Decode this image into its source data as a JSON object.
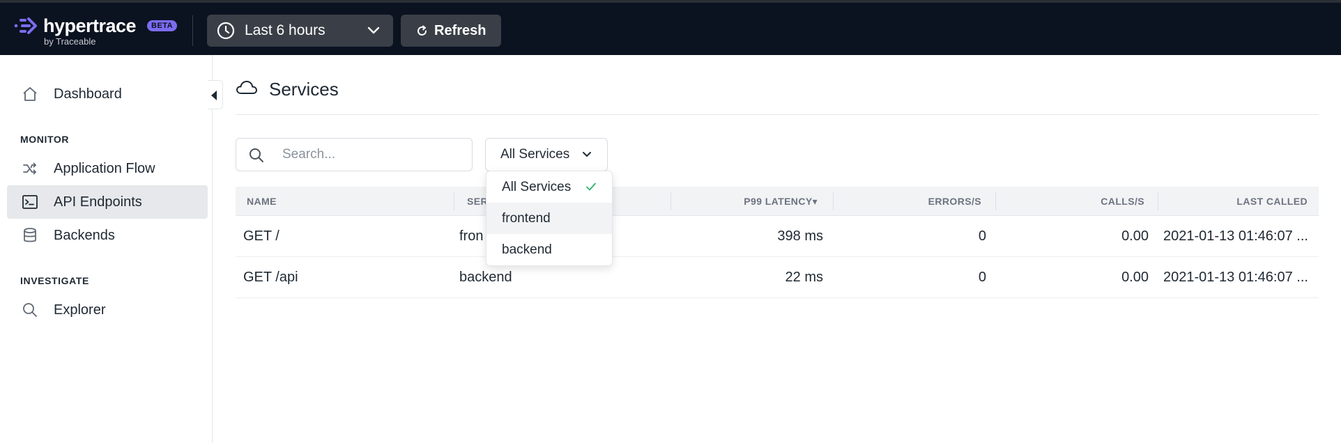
{
  "brand": {
    "name": "hypertrace",
    "badge": "BETA",
    "byline": "by Traceable",
    "accent": "#7c6cf0"
  },
  "toolbar": {
    "time_range": "Last 6 hours",
    "refresh_label": "Refresh"
  },
  "sidebar": {
    "items": [
      {
        "label": "Dashboard",
        "icon": "home-icon"
      },
      {
        "label": "Application Flow",
        "icon": "shuffle-icon"
      },
      {
        "label": "API Endpoints",
        "icon": "terminal-icon",
        "active": true
      },
      {
        "label": "Backends",
        "icon": "database-icon"
      },
      {
        "label": "Explorer",
        "icon": "search-icon"
      }
    ],
    "sections": {
      "monitor": "MONITOR",
      "investigate": "INVESTIGATE"
    }
  },
  "page": {
    "title": "Services",
    "icon": "cloud-icon"
  },
  "filters": {
    "search_placeholder": "Search...",
    "service_selected": "All Services",
    "service_options": [
      "All Services",
      "frontend",
      "backend"
    ]
  },
  "table": {
    "columns": [
      "NAME",
      "SER",
      "P99 LATENCY▾",
      "ERRORS/S",
      "CALLS/S",
      "LAST CALLED"
    ],
    "rows": [
      {
        "name": "GET /",
        "service": "fron",
        "latency": "398 ms",
        "errors": "0",
        "calls": "0.00",
        "last_called": "2021-01-13 01:46:07 ..."
      },
      {
        "name": "GET /api",
        "service": "backend",
        "latency": "22 ms",
        "errors": "0",
        "calls": "0.00",
        "last_called": "2021-01-13 01:46:07 ..."
      }
    ]
  },
  "colors": {
    "topbar": "#0b1220",
    "active_nav": "#e6e8eb",
    "check": "#2fb36e"
  }
}
